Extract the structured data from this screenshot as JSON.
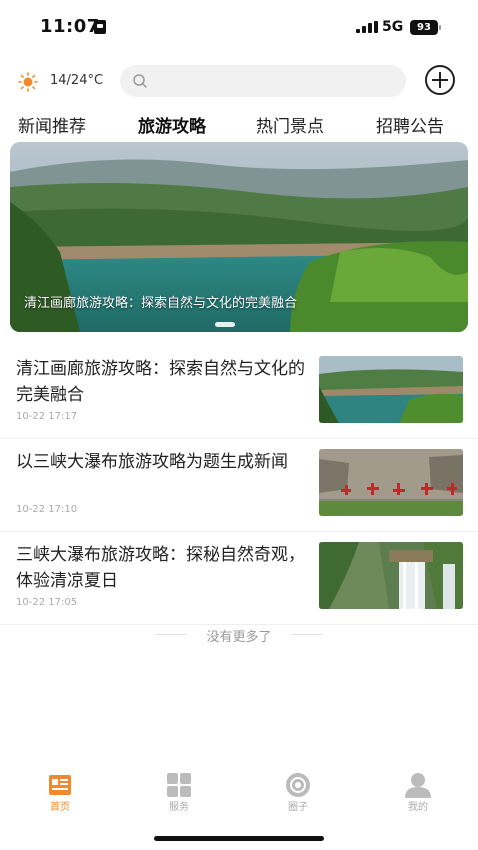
{
  "status_bar": {
    "time": "11:07",
    "network": "5G",
    "battery": "93"
  },
  "header": {
    "weather": "14/24°C",
    "search_placeholder": ""
  },
  "tabs": [
    {
      "label": "新闻推荐",
      "active": false
    },
    {
      "label": "旅游攻略",
      "active": true
    },
    {
      "label": "热门景点",
      "active": false
    },
    {
      "label": "招聘公告",
      "active": false
    }
  ],
  "banner": {
    "caption": "清江画廊旅游攻略：探索自然与文化的完美融合"
  },
  "news": [
    {
      "title": "清江画廊旅游攻略：探索自然与文化的完美融合",
      "time": "10-22 17:17"
    },
    {
      "title": "以三峡大瀑布旅游攻略为题生成新闻",
      "time": "10-22 17:10"
    },
    {
      "title": "三峡大瀑布旅游攻略：探秘自然奇观，体验清凉夏日",
      "time": "10-22 17:05"
    }
  ],
  "list_footer": "没有更多了",
  "bottom_nav": [
    {
      "label": "首页",
      "icon": "home-news-icon",
      "active": true
    },
    {
      "label": "服务",
      "icon": "grid-icon",
      "active": false
    },
    {
      "label": "圈子",
      "icon": "circle-icon",
      "active": false
    },
    {
      "label": "我的",
      "icon": "user-icon",
      "active": false
    }
  ],
  "colors": {
    "accent": "#f08a2c",
    "inactive": "#aaaaaa"
  }
}
